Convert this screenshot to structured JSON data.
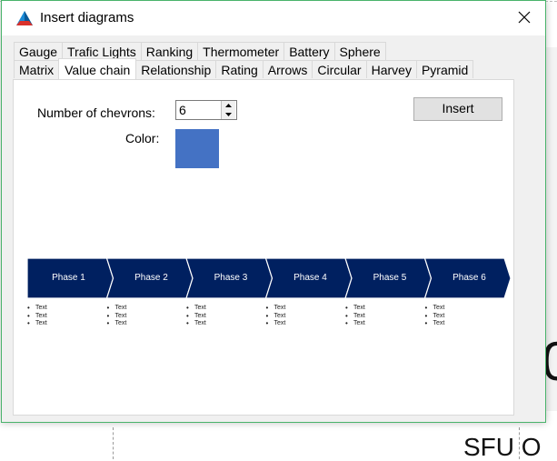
{
  "window": {
    "title": "Insert diagrams"
  },
  "tabs_row1": [
    "Gauge",
    "Trafic Lights",
    "Ranking",
    "Thermometer",
    "Battery",
    "Sphere"
  ],
  "tabs_row2": [
    "Matrix",
    "Value chain",
    "Relationship",
    "Rating",
    "Arrows",
    "Circular",
    "Harvey",
    "Pyramid"
  ],
  "active_tab": "Value chain",
  "form": {
    "chevrons_label": "Number of chevrons:",
    "chevrons_value": "6",
    "color_label": "Color:",
    "color_value": "#4472c4",
    "insert_label": "Insert"
  },
  "preview": {
    "chevron_color": "#002060",
    "phases": [
      {
        "label": "Phase 1",
        "bullets": [
          "Text",
          "Text",
          "Text"
        ]
      },
      {
        "label": "Phase 2",
        "bullets": [
          "Text",
          "Text",
          "Text"
        ]
      },
      {
        "label": "Phase 3",
        "bullets": [
          "Text",
          "Text",
          "Text"
        ]
      },
      {
        "label": "Phase 4",
        "bullets": [
          "Text",
          "Text",
          "Text"
        ]
      },
      {
        "label": "Phase 5",
        "bullets": [
          "Text",
          "Text",
          "Text"
        ]
      },
      {
        "label": "Phase 6",
        "bullets": [
          "Text",
          "Text",
          "Text"
        ]
      }
    ]
  },
  "background": {
    "big_glyph": "0",
    "bottom_text": "SFU O"
  },
  "icons": {
    "app": "triangle-logo-icon",
    "close": "close-icon",
    "spin_up": "arrow-up-icon",
    "spin_down": "arrow-down-icon"
  }
}
